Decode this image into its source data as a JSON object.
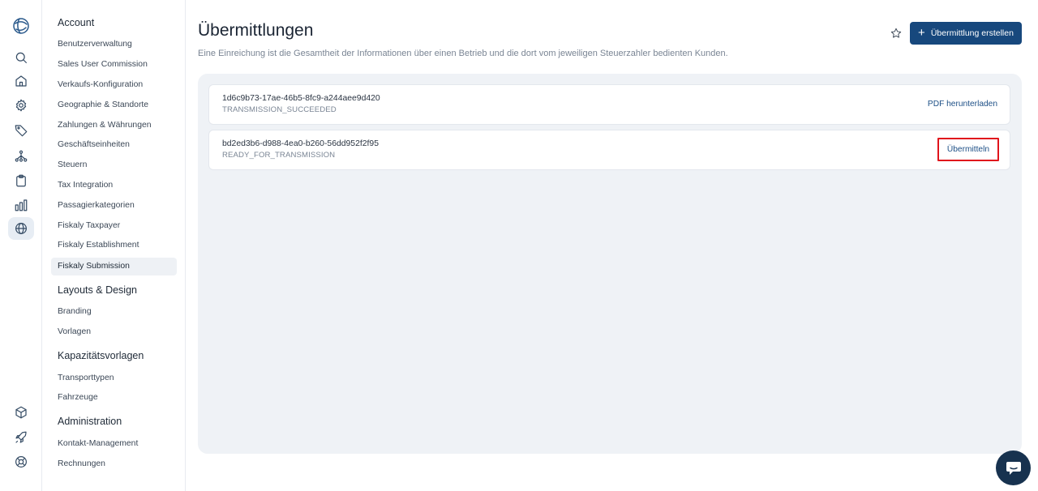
{
  "rail": {
    "icons": [
      "logo-globe-icon",
      "search-icon",
      "home-icon",
      "gear-icon",
      "tag-icon",
      "network-icon",
      "clipboard-icon",
      "bar-chart-icon",
      "globe-icon",
      "box-icon",
      "rocket-icon",
      "lifebuoy-icon"
    ]
  },
  "sidebar": {
    "sections": [
      {
        "title": "Account",
        "items": [
          "Benutzerverwaltung",
          "Sales User Commission",
          "Verkaufs-Konfiguration",
          "Geographie & Standorte",
          "Zahlungen & Währungen",
          "Geschäftseinheiten",
          "Steuern",
          "Tax Integration",
          "Passagierkategorien",
          "Fiskaly Taxpayer",
          "Fiskaly Establishment",
          "Fiskaly Submission"
        ]
      },
      {
        "title": "Layouts & Design",
        "items": [
          "Branding",
          "Vorlagen"
        ]
      },
      {
        "title": "Kapazitätsvorlagen",
        "items": [
          "Transporttypen",
          "Fahrzeuge"
        ]
      },
      {
        "title": "Administration",
        "items": [
          "Kontakt-Management",
          "Rechnungen"
        ]
      }
    ],
    "active_item": "Fiskaly Submission"
  },
  "header": {
    "title": "Übermittlungen",
    "subtitle": "Eine Einreichung ist die Gesamtheit der Informationen über einen Betrieb und die dort vom jeweiligen Steuerzahler bedienten Kunden.",
    "create_button": "Übermittlung erstellen",
    "create_button_plus": "+"
  },
  "submissions": [
    {
      "id": "1d6c9b73-17ae-46b5-8fc9-a244aee9d420",
      "status": "TRANSMISSION_SUCCEEDED",
      "action": "PDF herunterladen"
    },
    {
      "id": "bd2ed3b6-d988-4ea0-b260-56dd952f2f95",
      "status": "READY_FOR_TRANSMISSION",
      "action": "Übermitteln"
    }
  ],
  "colors": {
    "primary": "#17487d",
    "highlight": "#e0141c",
    "chat": "#17324f"
  }
}
